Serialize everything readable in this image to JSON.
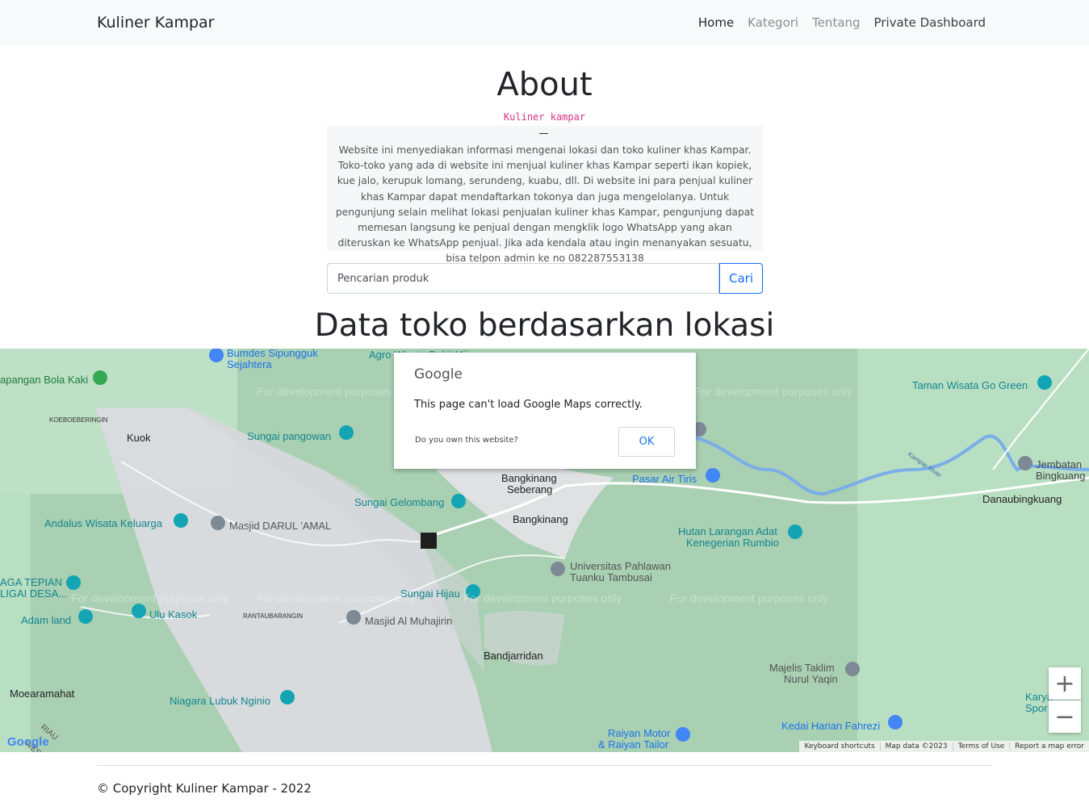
{
  "navbar": {
    "brand": "Kuliner Kampar",
    "links": [
      "Home",
      "Kategori",
      "Tentang",
      "Private Dashboard"
    ]
  },
  "about": {
    "title": "About",
    "code": "Kuliner kampar",
    "text": "Website ini menyediakan informasi mengenai lokasi dan toko kuliner khas Kampar. Toko-toko yang ada di website ini menjual kuliner khas Kampar seperti ikan kopiek, kue jalo, kerupuk lomang, serundeng, kuabu, dll. Di website ini para penjual kuliner khas Kampar dapat mendaftarkan tokonya dan juga mengelolanya. Untuk pengunjung selain melihat lokasi penjualan kuliner khas Kampar, pengunjung dapat memesan langsung ke penjual dengan mengklik logo WhatsApp yang akan diteruskan ke WhatsApp penjual. Jika ada kendala atau ingin menanyakan sesuatu, bisa telpon admin ke no 082287553138"
  },
  "search": {
    "placeholder": "Pencarian produk",
    "button": "Cari"
  },
  "data_title": "Data toko berdasarkan lokasi",
  "map": {
    "dialog": {
      "logo": "Google",
      "message": "This page can't load Google Maps correctly.",
      "own_question": "Do you own this website?",
      "ok": "OK"
    },
    "watermark": "For development purposes only",
    "zoom_in": "+",
    "zoom_out": "−",
    "google_logo": "Google",
    "attribution": [
      "Keyboard shortcuts",
      "Map data ©2023",
      "Terms of Use",
      "Report a map error"
    ],
    "labels": {
      "bumdes": [
        "Bumdes Sipungguk",
        "Sejahtera"
      ],
      "agro": "Agro Wisata Bukit Hijau",
      "lapangan": "apangan Bola Kaki",
      "koeboe": "KOEBOEBERINGIN",
      "kuok": "Kuok",
      "sungai_pangowan": "Sungai pangowan",
      "taman": "Taman Wisata Go Green",
      "kampar_river": "Kampar River",
      "jembatan": [
        "Jembatan",
        "Bingkuang"
      ],
      "pasar": "Pasar Air Tiris",
      "bangkinang_seberang": [
        "Bangkinang",
        "Seberang"
      ],
      "danaubingkuang": "Danaubingkuang",
      "sungai_gelombang": "Sungai Gelombang",
      "bangkinang": "Bangkinang",
      "andalus": "Andalus Wisata Keluarga",
      "masjid_darul": "Masjid DARUL 'AMAL",
      "hutan": [
        "Hutan Larangan Adat",
        "Kenegerian Rumbio"
      ],
      "univ": [
        "Universitas Pahlawan",
        "Tuanku Tambusai"
      ],
      "tepian": [
        "AGA TEPIAN",
        "LIGAI DESA..."
      ],
      "sungai_hijau": "Sungai Hijau",
      "adam": "Adam land",
      "ulu": "Ulu Kasok",
      "rantau": "RANTAUBARANGIN",
      "masjid_muhajirin": "Masjid Al Muhajirin",
      "bandjarridan": "Bandjarridan",
      "majelis": [
        "Majelis Taklim",
        "Nurul Yaqin"
      ],
      "moeara": "Moearamahat",
      "niagara": "Niagara Lubuk Nginio",
      "karya": [
        "Karya",
        "Spor"
      ],
      "kedai": "Kedai Harian Fahrezi",
      "raiyan": [
        "Raiyan Motor",
        "& Raiyan Tailor"
      ],
      "riau": "RIAU",
      "west": "WES"
    }
  },
  "footer": "© Copyright Kuliner Kampar - 2022"
}
